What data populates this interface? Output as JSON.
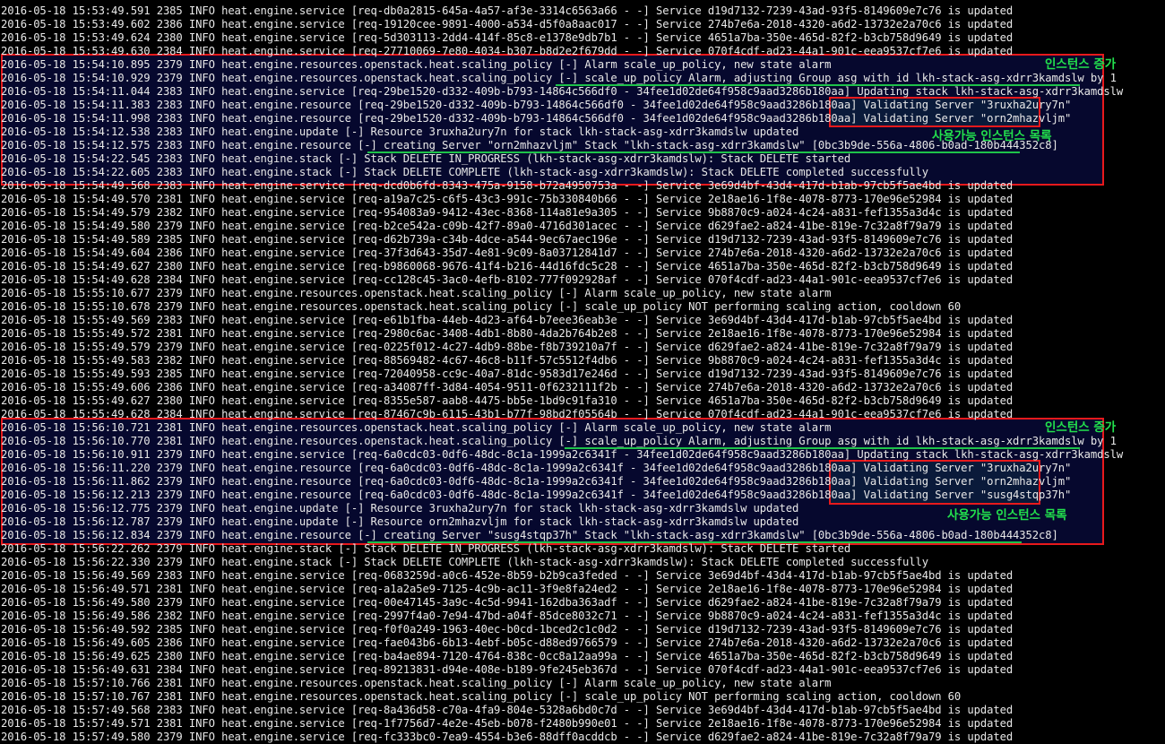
{
  "colors": {
    "background": "#000000",
    "text": "#e8e8e8",
    "box_border": "#e8191c",
    "box_fill": "#06082e",
    "annotation": "#22e04d",
    "underline": "#1ec24a"
  },
  "annotations": {
    "instance_increase_1": "인스턴스 증가",
    "available_instances_1": "사용가능 인스턴스 목록",
    "instance_increase_2": "인스턴스 증가",
    "available_instances_2": "사용가능 인스턴스 목록"
  },
  "log_lines": [
    "2016-05-18 15:53:49.591 2385 INFO heat.engine.service [req-db0a2815-645a-4a57-af3e-3314c6563a66 - -] Service d19d7132-7239-43ad-93f5-8149609e7c76 is updated",
    "2016-05-18 15:53:49.602 2386 INFO heat.engine.service [req-19120cee-9891-4000-a534-d5f0a8aac017 - -] Service 274b7e6a-2018-4320-a6d2-13732e2a70c6 is updated",
    "2016-05-18 15:53:49.624 2380 INFO heat.engine.service [req-5d303113-2dd4-414f-85c8-e1378e9db7b1 - -] Service 4651a7ba-350e-465d-82f2-b3cb758d9649 is updated",
    "2016-05-18 15:53:49.630 2384 INFO heat.engine.service [req-27710069-7e80-4034-b307-b8d2e2f679dd - -] Service 070f4cdf-ad23-44a1-901c-eea9537cf7e6 is updated",
    "2016-05-18 15:54:10.895 2379 INFO heat.engine.resources.openstack.heat.scaling_policy [-] Alarm scale_up_policy, new state alarm",
    "2016-05-18 15:54:10.929 2379 INFO heat.engine.resources.openstack.heat.scaling_policy [-] scale_up_policy Alarm, adjusting Group asg with id lkh-stack-asg-xdrr3kamdslw by 1",
    "2016-05-18 15:54:11.044 2383 INFO heat.engine.service [req-29be1520-d332-409b-b793-14864c566df0 - 34fee1d02de64f958c9aad3286b180aa] Updating stack lkh-stack-asg-xdrr3kamdslw",
    "2016-05-18 15:54:11.383 2383 INFO heat.engine.resource [req-29be1520-d332-409b-b793-14864c566df0 - 34fee1d02de64f958c9aad3286b180aa] Validating Server \"3ruxha2ury7n\"",
    "2016-05-18 15:54:11.998 2383 INFO heat.engine.resource [req-29be1520-d332-409b-b793-14864c566df0 - 34fee1d02de64f958c9aad3286b180aa] Validating Server \"orn2mhazvljm\"",
    "2016-05-18 15:54:12.538 2383 INFO heat.engine.update [-] Resource 3ruxha2ury7n for stack lkh-stack-asg-xdrr3kamdslw updated",
    "2016-05-18 15:54:12.575 2383 INFO heat.engine.resource [-] creating Server \"orn2mhazvljm\" Stack \"lkh-stack-asg-xdrr3kamdslw\" [0bc3b9de-556a-4806-b0ad-180b444352c8]",
    "2016-05-18 15:54:22.545 2383 INFO heat.engine.stack [-] Stack DELETE IN_PROGRESS (lkh-stack-asg-xdrr3kamdslw): Stack DELETE started",
    "2016-05-18 15:54:22.605 2383 INFO heat.engine.stack [-] Stack DELETE COMPLETE (lkh-stack-asg-xdrr3kamdslw): Stack DELETE completed successfully",
    "2016-05-18 15:54:49.568 2383 INFO heat.engine.service [req-dcd0b6fd-8343-475a-9158-b72a4950753a - -] Service 3e69d4bf-43d4-417d-b1ab-97cb5f5ae4bd is updated",
    "2016-05-18 15:54:49.570 2381 INFO heat.engine.service [req-a19a7c25-c6f5-43c3-991c-75b330840b66 - -] Service 2e18ae16-1f8e-4078-8773-170e96e52984 is updated",
    "2016-05-18 15:54:49.579 2382 INFO heat.engine.service [req-954083a9-9412-43ec-8368-114a81e9a305 - -] Service 9b8870c9-a024-4c24-a831-fef1355a3d4c is updated",
    "2016-05-18 15:54:49.580 2379 INFO heat.engine.service [req-b2ce542a-c09b-42f7-89a0-4716d301acec - -] Service d629fae2-a824-41be-819e-7c32a8f79a79 is updated",
    "2016-05-18 15:54:49.589 2385 INFO heat.engine.service [req-d62b739a-c34b-4dce-a544-9ec67aec196e - -] Service d19d7132-7239-43ad-93f5-8149609e7c76 is updated",
    "2016-05-18 15:54:49.604 2386 INFO heat.engine.service [req-37f3d643-35d7-4e81-9c09-8a03712841d7 - -] Service 274b7e6a-2018-4320-a6d2-13732e2a70c6 is updated",
    "2016-05-18 15:54:49.627 2380 INFO heat.engine.service [req-b9860068-9676-41f4-b216-44d16fdc5c28 - -] Service 4651a7ba-350e-465d-82f2-b3cb758d9649 is updated",
    "2016-05-18 15:54:49.628 2384 INFO heat.engine.service [req-cc128c45-3ac0-4efb-8102-777f092928af - -] Service 070f4cdf-ad23-44a1-901c-eea9537cf7e6 is updated",
    "2016-05-18 15:55:10.677 2379 INFO heat.engine.resources.openstack.heat.scaling_policy [-] Alarm scale_up_policy, new state alarm",
    "2016-05-18 15:55:10.678 2379 INFO heat.engine.resources.openstack.heat.scaling_policy [-] scale_up_policy NOT performing scaling action, cooldown 60",
    "2016-05-18 15:55:49.569 2383 INFO heat.engine.service [req-e61b1fba-44eb-4d23-af64-b7eee36eab3e - -] Service 3e69d4bf-43d4-417d-b1ab-97cb5f5ae4bd is updated",
    "2016-05-18 15:55:49.572 2381 INFO heat.engine.service [req-2980c6ac-3408-4db1-8b80-4da2b764b2e8 - -] Service 2e18ae16-1f8e-4078-8773-170e96e52984 is updated",
    "2016-05-18 15:55:49.579 2379 INFO heat.engine.service [req-0225f012-4c27-4db9-88be-f8b739210a7f - -] Service d629fae2-a824-41be-819e-7c32a8f79a79 is updated",
    "2016-05-18 15:55:49.583 2382 INFO heat.engine.service [req-88569482-4c67-46c8-b11f-57c5512f4db6 - -] Service 9b8870c9-a024-4c24-a831-fef1355a3d4c is updated",
    "2016-05-18 15:55:49.593 2385 INFO heat.engine.service [req-72040958-cc9c-40a7-81dc-9583d17e246d - -] Service d19d7132-7239-43ad-93f5-8149609e7c76 is updated",
    "2016-05-18 15:55:49.606 2386 INFO heat.engine.service [req-a34087ff-3d84-4054-9511-0f6232111f2b - -] Service 274b7e6a-2018-4320-a6d2-13732e2a70c6 is updated",
    "2016-05-18 15:55:49.627 2380 INFO heat.engine.service [req-8355e587-aab8-4475-bb5e-1bd9c91fa310 - -] Service 4651a7ba-350e-465d-82f2-b3cb758d9649 is updated",
    "2016-05-18 15:55:49.628 2384 INFO heat.engine.service [req-87467c9b-6115-43b1-b77f-98bd2f05564b - -] Service 070f4cdf-ad23-44a1-901c-eea9537cf7e6 is updated",
    "2016-05-18 15:56:10.721 2381 INFO heat.engine.resources.openstack.heat.scaling_policy [-] Alarm scale_up_policy, new state alarm",
    "2016-05-18 15:56:10.770 2381 INFO heat.engine.resources.openstack.heat.scaling_policy [-] scale_up_policy Alarm, adjusting Group asg with id lkh-stack-asg-xdrr3kamdslw by 1",
    "2016-05-18 15:56:10.911 2379 INFO heat.engine.service [req-6a0cdc03-0df6-48dc-8c1a-1999a2c6341f - 34fee1d02de64f958c9aad3286b180aa] Updating stack lkh-stack-asg-xdrr3kamdslw",
    "2016-05-18 15:56:11.220 2379 INFO heat.engine.resource [req-6a0cdc03-0df6-48dc-8c1a-1999a2c6341f - 34fee1d02de64f958c9aad3286b180aa] Validating Server \"3ruxha2ury7n\"",
    "2016-05-18 15:56:11.862 2379 INFO heat.engine.resource [req-6a0cdc03-0df6-48dc-8c1a-1999a2c6341f - 34fee1d02de64f958c9aad3286b180aa] Validating Server \"orn2mhazvljm\"",
    "2016-05-18 15:56:12.213 2379 INFO heat.engine.resource [req-6a0cdc03-0df6-48dc-8c1a-1999a2c6341f - 34fee1d02de64f958c9aad3286b180aa] Validating Server \"susg4stqp37h\"",
    "2016-05-18 15:56:12.775 2379 INFO heat.engine.update [-] Resource 3ruxha2ury7n for stack lkh-stack-asg-xdrr3kamdslw updated",
    "2016-05-18 15:56:12.787 2379 INFO heat.engine.update [-] Resource orn2mhazvljm for stack lkh-stack-asg-xdrr3kamdslw updated",
    "2016-05-18 15:56:12.834 2379 INFO heat.engine.resource [-] creating Server \"susg4stqp37h\" Stack \"lkh-stack-asg-xdrr3kamdslw\" [0bc3b9de-556a-4806-b0ad-180b444352c8]",
    "2016-05-18 15:56:22.262 2379 INFO heat.engine.stack [-] Stack DELETE IN_PROGRESS (lkh-stack-asg-xdrr3kamdslw): Stack DELETE started",
    "2016-05-18 15:56:22.330 2379 INFO heat.engine.stack [-] Stack DELETE COMPLETE (lkh-stack-asg-xdrr3kamdslw): Stack DELETE completed successfully",
    "2016-05-18 15:56:49.569 2383 INFO heat.engine.service [req-0683259d-a0c6-452e-8b59-b2b9ca3feded - -] Service 3e69d4bf-43d4-417d-b1ab-97cb5f5ae4bd is updated",
    "2016-05-18 15:56:49.571 2381 INFO heat.engine.service [req-a1a2a5e9-7125-4c9b-ac11-3f9e8fa24ed2 - -] Service 2e18ae16-1f8e-4078-8773-170e96e52984 is updated",
    "2016-05-18 15:56:49.580 2379 INFO heat.engine.service [req-00e47145-3a9c-4c5d-9941-162dba363adf - -] Service d629fae2-a824-41be-819e-7c32a8f79a79 is updated",
    "2016-05-18 15:56:49.586 2382 INFO heat.engine.service [req-2997f4a0-7e94-47bd-a04f-85dce8032c71 - -] Service 9b8870c9-a024-4c24-a831-fef1355a3d4c is updated",
    "2016-05-18 15:56:49.592 2385 INFO heat.engine.service [req-f0f0a249-1963-40ec-b0cd-1bced2c1c0d2 - -] Service d19d7132-7239-43ad-93f5-8149609e7c76 is updated",
    "2016-05-18 15:56:49.605 2386 INFO heat.engine.service [req-fae043b6-6b13-4ebf-b05c-d88ed9766579 - -] Service 274b7e6a-2018-4320-a6d2-13732e2a70c6 is updated",
    "2016-05-18 15:56:49.625 2380 INFO heat.engine.service [req-ba4ae894-7120-4764-838c-0cc8a12aa99a - -] Service 4651a7ba-350e-465d-82f2-b3cb758d9649 is updated",
    "2016-05-18 15:56:49.631 2384 INFO heat.engine.service [req-89213831-d94e-408e-b189-9fe245eb367d - -] Service 070f4cdf-ad23-44a1-901c-eea9537cf7e6 is updated",
    "2016-05-18 15:57:10.766 2381 INFO heat.engine.resources.openstack.heat.scaling_policy [-] Alarm scale_up_policy, new state alarm",
    "2016-05-18 15:57:10.767 2381 INFO heat.engine.resources.openstack.heat.scaling_policy [-] scale_up_policy NOT performing scaling action, cooldown 60",
    "2016-05-18 15:57:49.568 2383 INFO heat.engine.service [req-8a436d58-c70a-4fa9-804e-5328a6bd0c7d - -] Service 3e69d4bf-43d4-417d-b1ab-97cb5f5ae4bd is updated",
    "2016-05-18 15:57:49.571 2381 INFO heat.engine.service [req-1f7756d7-4e2e-45eb-b078-f2480b990e01 - -] Service 2e18ae16-1f8e-4078-8773-170e96e52984 is updated",
    "2016-05-18 15:57:49.580 2379 INFO heat.engine.service [req-fc333bc0-7ea9-4554-b3e6-88dff0acddcb - -] Service d629fae2-a824-41be-819e-7c32a8f79a79 is updated"
  ]
}
